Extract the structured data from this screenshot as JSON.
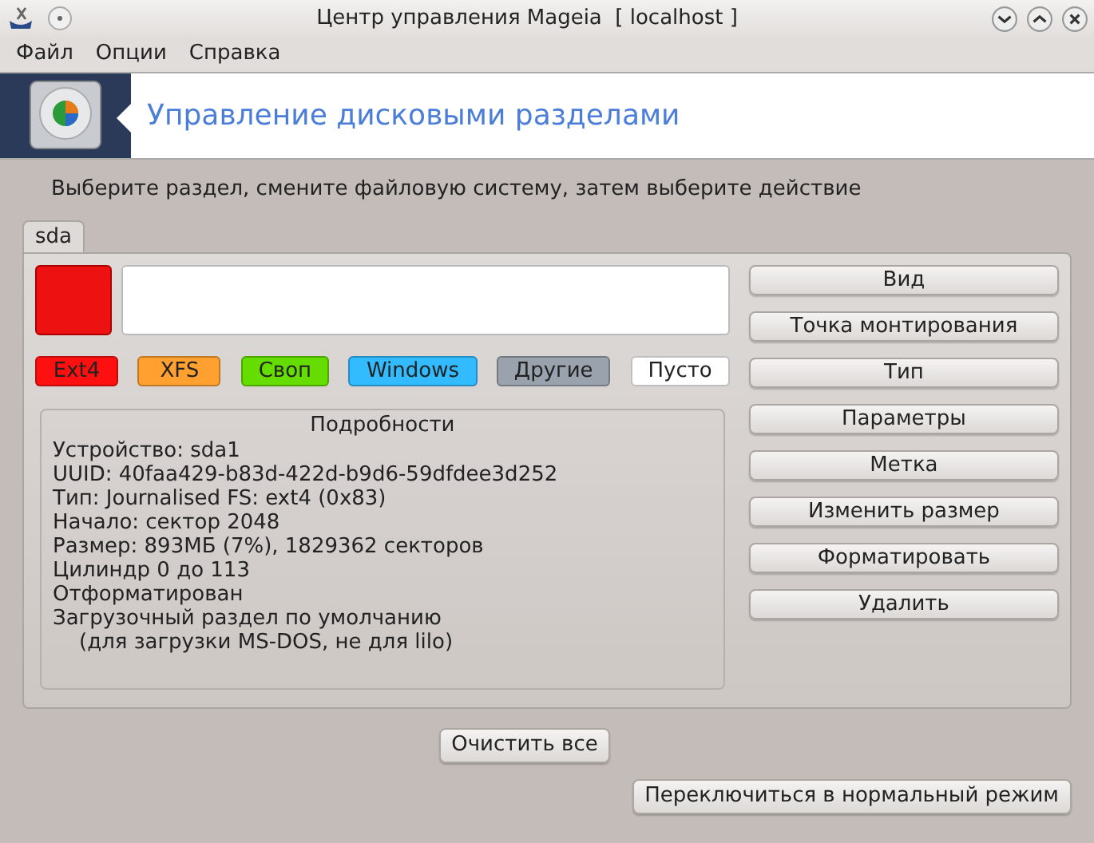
{
  "window": {
    "title": "Центр управления Mageia  [ localhost ]"
  },
  "menu": [
    {
      "label": "Файл"
    },
    {
      "label": "Опции"
    },
    {
      "label": "Справка"
    }
  ],
  "banner": {
    "title": "Управление дисковыми разделами"
  },
  "instruction": "Выберите раздел, смените файловую систему, затем выберите действие",
  "tabs": [
    {
      "label": "sda",
      "selected": true
    }
  ],
  "partitions": [
    {
      "kind": "filled",
      "color": "#ee1111",
      "selected": true
    },
    {
      "kind": "empty",
      "color": "#ffffff",
      "selected": false
    }
  ],
  "legend": [
    {
      "label": "Ext4",
      "color": "#ff1010"
    },
    {
      "label": "XFS",
      "color": "#ffa030"
    },
    {
      "label": "Своп",
      "color": "#66dd00"
    },
    {
      "label": "Windows",
      "color": "#33bbff"
    },
    {
      "label": "Другие",
      "color": "#9aa2ad"
    },
    {
      "label": "Пусто",
      "color": "#ffffff"
    }
  ],
  "details": {
    "title": "Подробности",
    "lines": [
      "Устройство: sda1",
      "UUID: 40faa429-b83d-422d-b9d6-59dfdee3d252",
      "Тип: Journalised FS: ext4 (0x83)",
      "Начало: сектор 2048",
      "Размер: 893МБ (7%), 1829362 секторов",
      "Цилиндр 0 до 113",
      "Отформатирован",
      "Загрузочный раздел по умолчанию",
      "    (для загрузки MS-DOS, не для lilo)"
    ]
  },
  "actions": [
    "Вид",
    "Точка монтирования",
    "Тип",
    "Параметры",
    "Метка",
    "Изменить размер",
    "Форматировать",
    "Удалить"
  ],
  "buttons": [
    "Очистить все",
    "Переключиться в нормальный режим"
  ]
}
